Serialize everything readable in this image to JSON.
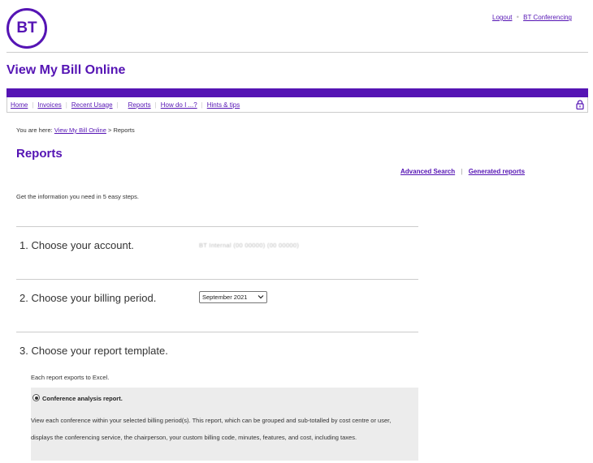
{
  "header": {
    "logo_text": "BT",
    "logout_label": "Logout",
    "conferencing_label": "BT Conferencing",
    "separator": "•"
  },
  "app_title": "View My Bill Online",
  "nav": {
    "items": [
      {
        "label": "Home"
      },
      {
        "label": "Invoices"
      },
      {
        "label": "Recent Usage"
      },
      {
        "label": "Reports"
      },
      {
        "label": "How do I ...?"
      },
      {
        "label": "Hints & tips"
      }
    ],
    "lock_icon": "lock-icon"
  },
  "breadcrumb": {
    "prefix": "You are here: ",
    "link": "View My Bill Online",
    "current": " > Reports"
  },
  "page_title": "Reports",
  "right_links": {
    "advanced_search": "Advanced Search",
    "generated_reports": "Generated reports",
    "separator": "|"
  },
  "intro": "Get the information you need in 5 easy steps.",
  "steps": {
    "step1": "1. Choose your account.",
    "account_value": "BT Internal (00 00000) (00 00000)",
    "step2": "2. Choose your billing period.",
    "billing_period_selected": "September 2021",
    "step3": "3. Choose your report template."
  },
  "report": {
    "exports_note": "Each report exports to Excel.",
    "option_label": "Conference analysis report.",
    "description": "View each conference within your selected billing period(s). This report, which can be grouped and sub-totalled by cost centre or user, displays the conferencing service, the chairperson, your custom billing code, minutes, features, and cost, including taxes."
  },
  "colors": {
    "brand": "#5514b4",
    "divider": "#cccccc",
    "panel": "#ececec"
  }
}
